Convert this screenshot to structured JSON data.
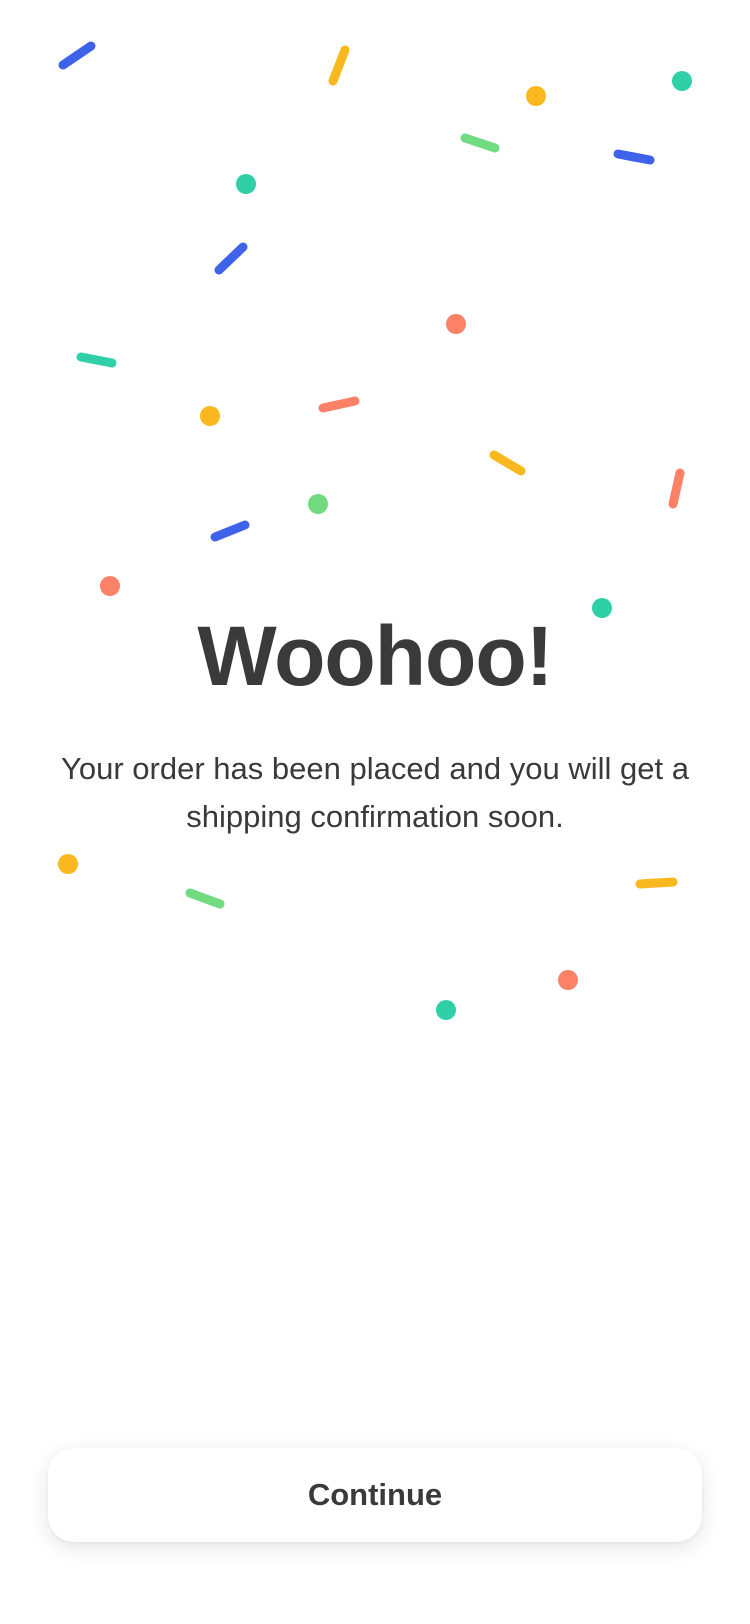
{
  "confirmation": {
    "title": "Woohoo!",
    "message": "Your order has been placed and you will get a shipping confirmation soon."
  },
  "actions": {
    "continue_label": "Continue"
  },
  "colors": {
    "text": "#3a3a3a",
    "confetti_blue": "#3e63ea",
    "confetti_yellow": "#f8b81e",
    "confetti_teal": "#2fd0a8",
    "confetti_green": "#71db82",
    "confetti_salmon": "#fb8266",
    "button_background": "#ffffff"
  }
}
